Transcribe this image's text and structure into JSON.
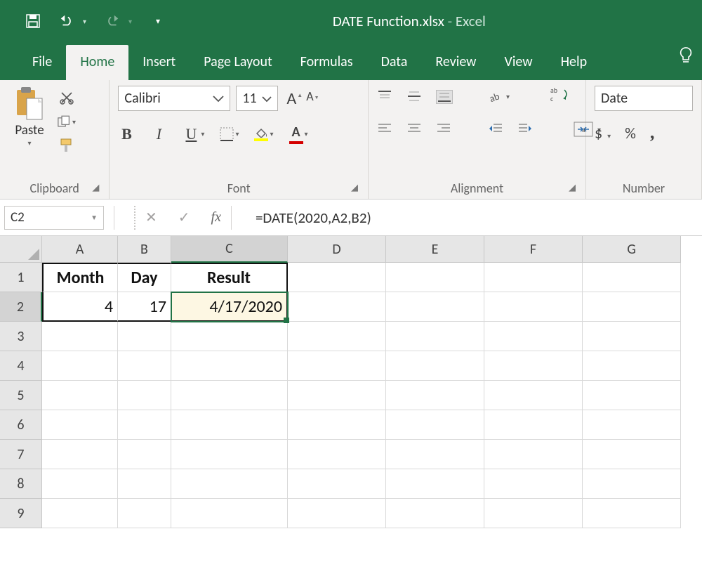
{
  "title": {
    "filename": "DATE Function.xlsx",
    "dash": " - ",
    "app": "Excel"
  },
  "tabs": {
    "file": "File",
    "home": "Home",
    "insert": "Insert",
    "page_layout": "Page Layout",
    "formulas": "Formulas",
    "data": "Data",
    "review": "Review",
    "view": "View",
    "help": "Help"
  },
  "ribbon": {
    "clipboard": {
      "paste": "Paste",
      "label": "Clipboard"
    },
    "font": {
      "name": "Calibri",
      "size": "11",
      "label": "Font",
      "bold": "B",
      "italic": "I",
      "underline": "U",
      "bigA": "A",
      "smallA": "A",
      "fillA": "A",
      "fontA": "A"
    },
    "alignment": {
      "label": "Alignment"
    },
    "number": {
      "format": "Date",
      "label": "Number",
      "currency": "$",
      "percent": "%",
      "comma": ","
    }
  },
  "formula_bar": {
    "namebox": "C2",
    "cancel": "✕",
    "enter": "✓",
    "fx": "fx",
    "formula": "=DATE(2020,A2,B2)"
  },
  "columns": [
    "A",
    "B",
    "C",
    "D",
    "E",
    "F",
    "G"
  ],
  "rows": [
    "1",
    "2",
    "3",
    "4",
    "5",
    "6",
    "7",
    "8",
    "9"
  ],
  "cells": {
    "A1": "Month",
    "B1": "Day",
    "C1": "Result",
    "A2": "4",
    "B2": "17",
    "C2": "4/17/2020"
  }
}
